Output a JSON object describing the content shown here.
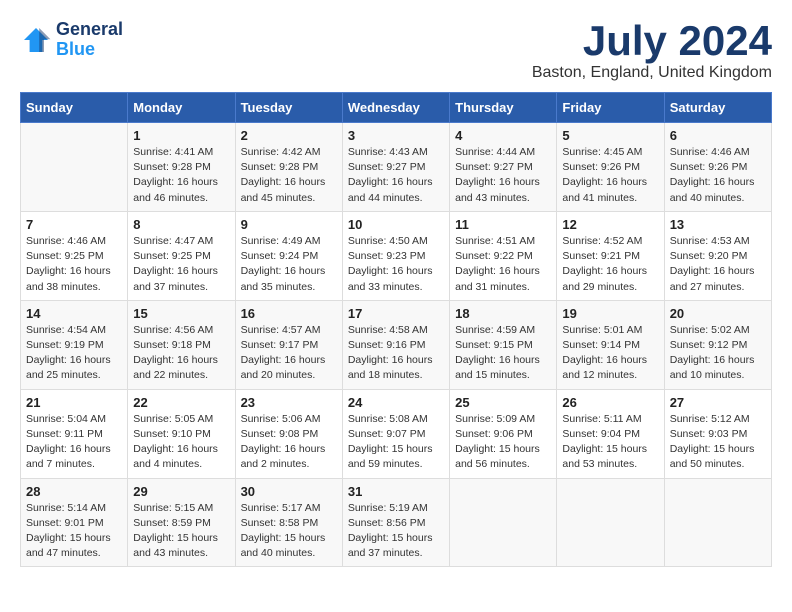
{
  "header": {
    "logo_line1": "General",
    "logo_line2": "Blue",
    "month": "July 2024",
    "location": "Baston, England, United Kingdom"
  },
  "weekdays": [
    "Sunday",
    "Monday",
    "Tuesday",
    "Wednesday",
    "Thursday",
    "Friday",
    "Saturday"
  ],
  "weeks": [
    [
      {
        "day": "",
        "sunrise": "",
        "sunset": "",
        "daylight": ""
      },
      {
        "day": "1",
        "sunrise": "4:41 AM",
        "sunset": "9:28 PM",
        "daylight": "16 hours and 46 minutes."
      },
      {
        "day": "2",
        "sunrise": "4:42 AM",
        "sunset": "9:28 PM",
        "daylight": "16 hours and 45 minutes."
      },
      {
        "day": "3",
        "sunrise": "4:43 AM",
        "sunset": "9:27 PM",
        "daylight": "16 hours and 44 minutes."
      },
      {
        "day": "4",
        "sunrise": "4:44 AM",
        "sunset": "9:27 PM",
        "daylight": "16 hours and 43 minutes."
      },
      {
        "day": "5",
        "sunrise": "4:45 AM",
        "sunset": "9:26 PM",
        "daylight": "16 hours and 41 minutes."
      },
      {
        "day": "6",
        "sunrise": "4:46 AM",
        "sunset": "9:26 PM",
        "daylight": "16 hours and 40 minutes."
      }
    ],
    [
      {
        "day": "7",
        "sunrise": "4:46 AM",
        "sunset": "9:25 PM",
        "daylight": "16 hours and 38 minutes."
      },
      {
        "day": "8",
        "sunrise": "4:47 AM",
        "sunset": "9:25 PM",
        "daylight": "16 hours and 37 minutes."
      },
      {
        "day": "9",
        "sunrise": "4:49 AM",
        "sunset": "9:24 PM",
        "daylight": "16 hours and 35 minutes."
      },
      {
        "day": "10",
        "sunrise": "4:50 AM",
        "sunset": "9:23 PM",
        "daylight": "16 hours and 33 minutes."
      },
      {
        "day": "11",
        "sunrise": "4:51 AM",
        "sunset": "9:22 PM",
        "daylight": "16 hours and 31 minutes."
      },
      {
        "day": "12",
        "sunrise": "4:52 AM",
        "sunset": "9:21 PM",
        "daylight": "16 hours and 29 minutes."
      },
      {
        "day": "13",
        "sunrise": "4:53 AM",
        "sunset": "9:20 PM",
        "daylight": "16 hours and 27 minutes."
      }
    ],
    [
      {
        "day": "14",
        "sunrise": "4:54 AM",
        "sunset": "9:19 PM",
        "daylight": "16 hours and 25 minutes."
      },
      {
        "day": "15",
        "sunrise": "4:56 AM",
        "sunset": "9:18 PM",
        "daylight": "16 hours and 22 minutes."
      },
      {
        "day": "16",
        "sunrise": "4:57 AM",
        "sunset": "9:17 PM",
        "daylight": "16 hours and 20 minutes."
      },
      {
        "day": "17",
        "sunrise": "4:58 AM",
        "sunset": "9:16 PM",
        "daylight": "16 hours and 18 minutes."
      },
      {
        "day": "18",
        "sunrise": "4:59 AM",
        "sunset": "9:15 PM",
        "daylight": "16 hours and 15 minutes."
      },
      {
        "day": "19",
        "sunrise": "5:01 AM",
        "sunset": "9:14 PM",
        "daylight": "16 hours and 12 minutes."
      },
      {
        "day": "20",
        "sunrise": "5:02 AM",
        "sunset": "9:12 PM",
        "daylight": "16 hours and 10 minutes."
      }
    ],
    [
      {
        "day": "21",
        "sunrise": "5:04 AM",
        "sunset": "9:11 PM",
        "daylight": "16 hours and 7 minutes."
      },
      {
        "day": "22",
        "sunrise": "5:05 AM",
        "sunset": "9:10 PM",
        "daylight": "16 hours and 4 minutes."
      },
      {
        "day": "23",
        "sunrise": "5:06 AM",
        "sunset": "9:08 PM",
        "daylight": "16 hours and 2 minutes."
      },
      {
        "day": "24",
        "sunrise": "5:08 AM",
        "sunset": "9:07 PM",
        "daylight": "15 hours and 59 minutes."
      },
      {
        "day": "25",
        "sunrise": "5:09 AM",
        "sunset": "9:06 PM",
        "daylight": "15 hours and 56 minutes."
      },
      {
        "day": "26",
        "sunrise": "5:11 AM",
        "sunset": "9:04 PM",
        "daylight": "15 hours and 53 minutes."
      },
      {
        "day": "27",
        "sunrise": "5:12 AM",
        "sunset": "9:03 PM",
        "daylight": "15 hours and 50 minutes."
      }
    ],
    [
      {
        "day": "28",
        "sunrise": "5:14 AM",
        "sunset": "9:01 PM",
        "daylight": "15 hours and 47 minutes."
      },
      {
        "day": "29",
        "sunrise": "5:15 AM",
        "sunset": "8:59 PM",
        "daylight": "15 hours and 43 minutes."
      },
      {
        "day": "30",
        "sunrise": "5:17 AM",
        "sunset": "8:58 PM",
        "daylight": "15 hours and 40 minutes."
      },
      {
        "day": "31",
        "sunrise": "5:19 AM",
        "sunset": "8:56 PM",
        "daylight": "15 hours and 37 minutes."
      },
      {
        "day": "",
        "sunrise": "",
        "sunset": "",
        "daylight": ""
      },
      {
        "day": "",
        "sunrise": "",
        "sunset": "",
        "daylight": ""
      },
      {
        "day": "",
        "sunrise": "",
        "sunset": "",
        "daylight": ""
      }
    ]
  ]
}
